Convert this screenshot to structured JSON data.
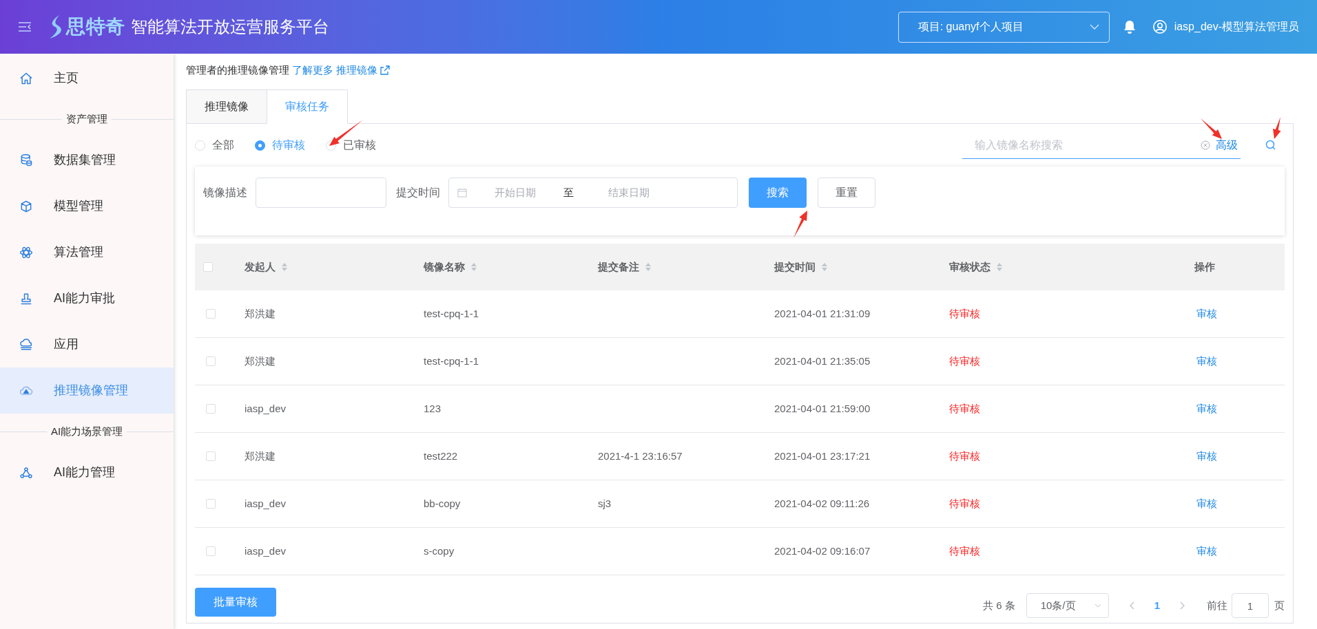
{
  "header": {
    "brand": "思特奇",
    "title": "智能算法开放运营服务平台",
    "project": "项目: guanyf个人项目",
    "user": "iasp_dev-模型算法管理员"
  },
  "sidebar": {
    "items": [
      {
        "kind": "item",
        "label": "主页",
        "selected": false
      },
      {
        "kind": "section",
        "label": "资产管理"
      },
      {
        "kind": "item",
        "label": "数据集管理",
        "selected": false
      },
      {
        "kind": "item",
        "label": "模型管理",
        "selected": false
      },
      {
        "kind": "item",
        "label": "算法管理",
        "selected": false
      },
      {
        "kind": "item",
        "label": "AI能力审批",
        "selected": false
      },
      {
        "kind": "item",
        "label": "应用",
        "selected": false
      },
      {
        "kind": "item",
        "label": "推理镜像管理",
        "selected": true
      },
      {
        "kind": "section",
        "label": "AI能力场景管理"
      },
      {
        "kind": "item",
        "label": "AI能力管理",
        "selected": false
      }
    ]
  },
  "intro": {
    "text": "管理者的推理镜像管理",
    "link": "了解更多 推理镜像"
  },
  "tabs": [
    {
      "label": "推理镜像",
      "selected": false
    },
    {
      "label": "审核任务",
      "selected": true
    }
  ],
  "filter": {
    "radios": [
      {
        "label": "全部",
        "selected": false
      },
      {
        "label": "待审核",
        "selected": true
      },
      {
        "label": "已审核",
        "selected": false
      }
    ],
    "search_placeholder": "输入镜像名称搜索",
    "advanced": "高级"
  },
  "advanced_search": {
    "desc_label": "镜像描述",
    "time_label": "提交时间",
    "start_placeholder": "开始日期",
    "separator": "至",
    "end_placeholder": "结束日期",
    "search": "搜索",
    "reset": "重置"
  },
  "table": {
    "header_checked": false,
    "columns": [
      {
        "label": "发起人",
        "sortable": true
      },
      {
        "label": "镜像名称",
        "sortable": true
      },
      {
        "label": "提交备注",
        "sortable": true
      },
      {
        "label": "提交时间",
        "sortable": true
      },
      {
        "label": "审核状态",
        "sortable": true
      },
      {
        "label": "操作",
        "sortable": false
      }
    ],
    "rows": [
      {
        "checked": false,
        "initiator": "郑洪建",
        "image": "test-cpq-1-1",
        "time": "2021-04-01 21:31:09",
        "status": "待审核",
        "action": "审核"
      },
      {
        "checked": false,
        "initiator": "郑洪建",
        "image": "test-cpq-1-1",
        "time": "2021-04-01 21:35:05",
        "status": "待审核",
        "action": "审核"
      },
      {
        "checked": false,
        "initiator": "iasp_dev",
        "image": "123",
        "time": "2021-04-01 21:59:00",
        "status": "待审核",
        "action": "审核"
      },
      {
        "checked": false,
        "initiator": "郑洪建",
        "image": "test222",
        "note": "2021-4-1 23:16:57",
        "time": "2021-04-01 23:17:21",
        "status": "待审核",
        "action": "审核"
      },
      {
        "checked": false,
        "initiator": "iasp_dev",
        "image": "bb-copy",
        "note": "sj3",
        "time": "2021-04-02 09:11:26",
        "status": "待审核",
        "action": "审核"
      },
      {
        "checked": false,
        "initiator": "iasp_dev",
        "image": "s-copy",
        "time": "2021-04-02 09:16:07",
        "status": "待审核",
        "action": "审核"
      }
    ]
  },
  "footer": {
    "batch": "批量审核",
    "total": "共 6 条",
    "page_size": "10条/页",
    "pages": [
      {
        "label": "1",
        "selected": true
      }
    ],
    "goto_label": "前往",
    "goto_value": "1",
    "goto_suffix": "页"
  }
}
